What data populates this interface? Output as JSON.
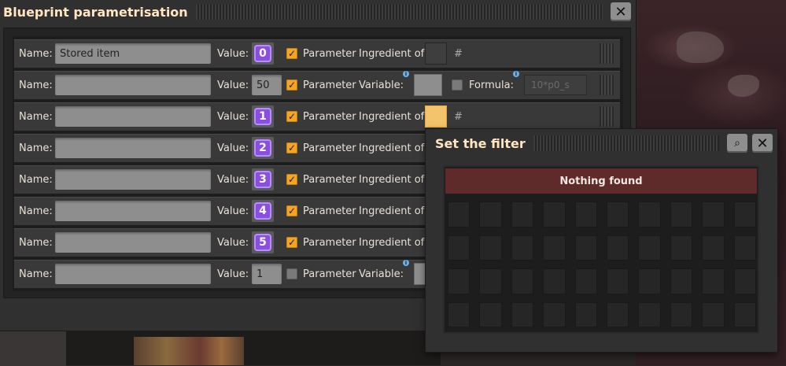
{
  "blueprint_window": {
    "title": "Blueprint parametrisation",
    "close_label": "✕",
    "rows": [
      {
        "name_label": "Name:",
        "name_value": "Stored item",
        "value_label": "Value:",
        "value_kind": "signal",
        "value": "0",
        "parameter_checked": true,
        "parameter_label": "Parameter",
        "extra_label": "Ingredient of:",
        "extra_kind": "ingredient",
        "slot_state": "empty",
        "hash": "#"
      },
      {
        "name_label": "Name:",
        "name_value": "",
        "value_label": "Value:",
        "value_kind": "number",
        "value": "50",
        "parameter_checked": true,
        "parameter_label": "Parameter",
        "extra_label": "Variable:",
        "extra_kind": "variable",
        "formula_label": "Formula:",
        "formula_placeholder": "10*p0_s"
      },
      {
        "name_label": "Name:",
        "name_value": "",
        "value_label": "Value:",
        "value_kind": "signal",
        "value": "1",
        "parameter_checked": true,
        "parameter_label": "Parameter",
        "extra_label": "Ingredient of:",
        "extra_kind": "ingredient",
        "slot_state": "selected",
        "hash": "#"
      },
      {
        "name_label": "Name:",
        "name_value": "",
        "value_label": "Value:",
        "value_kind": "signal",
        "value": "2",
        "parameter_checked": true,
        "parameter_label": "Parameter",
        "extra_label": "Ingredient of:",
        "extra_kind": "ingredient"
      },
      {
        "name_label": "Name:",
        "name_value": "",
        "value_label": "Value:",
        "value_kind": "signal",
        "value": "3",
        "parameter_checked": true,
        "parameter_label": "Parameter",
        "extra_label": "Ingredient of:",
        "extra_kind": "ingredient"
      },
      {
        "name_label": "Name:",
        "name_value": "",
        "value_label": "Value:",
        "value_kind": "signal",
        "value": "4",
        "parameter_checked": true,
        "parameter_label": "Parameter",
        "extra_label": "Ingredient of:",
        "extra_kind": "ingredient"
      },
      {
        "name_label": "Name:",
        "name_value": "",
        "value_label": "Value:",
        "value_kind": "signal",
        "value": "5",
        "parameter_checked": true,
        "parameter_label": "Parameter",
        "extra_label": "Ingredient of:",
        "extra_kind": "ingredient"
      },
      {
        "name_label": "Name:",
        "name_value": "",
        "value_label": "Value:",
        "value_kind": "number",
        "value": "1",
        "parameter_checked": false,
        "parameter_label": "Parameter",
        "extra_label": "Variable:",
        "extra_kind": "variable"
      }
    ]
  },
  "filter_window": {
    "title": "Set the filter",
    "search_label": "⌕",
    "close_label": "✕",
    "empty_message": "Nothing found",
    "grid_rows": 4,
    "grid_cols": 10
  },
  "colors": {
    "checkbox_on": "#f4a623",
    "signal_badge": "#8a4ee0",
    "selected_slot": "#f4c46a",
    "nothing_found_bg": "#5e2a2a"
  }
}
